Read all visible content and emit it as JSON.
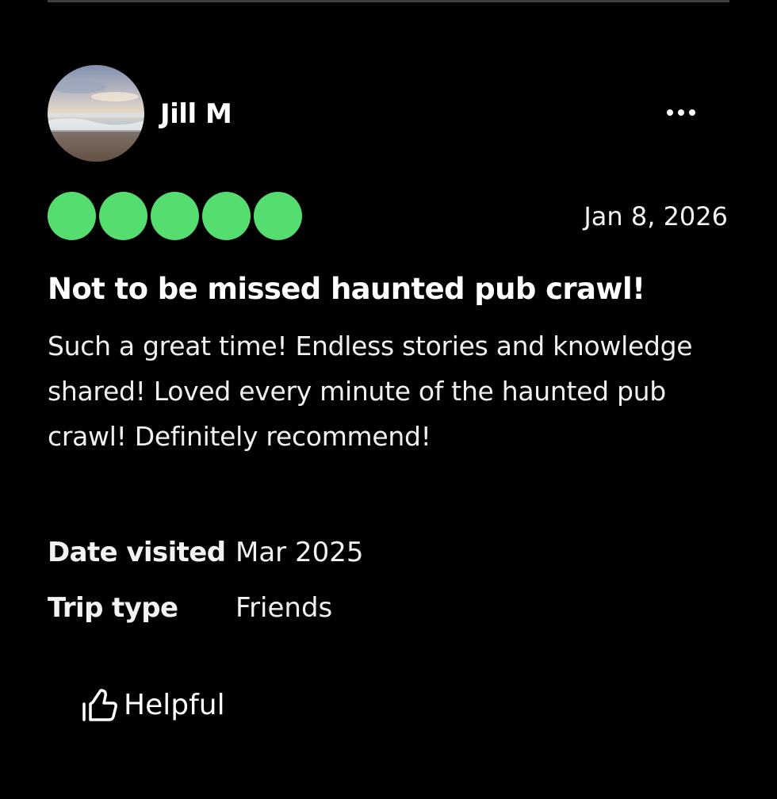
{
  "review": {
    "author": {
      "name": "Jill M",
      "avatar_icon": "beach-photo"
    },
    "menu_icon": "more-dots-icon",
    "rating": {
      "value": 5,
      "max": 5,
      "color": "#56dd6f"
    },
    "date": "Jan 8, 2026",
    "title": "Not to be missed haunted pub crawl!",
    "body": "Such a great time! Endless stories and knowledge shared! Loved every minute of the haunted pub crawl! Definitely recommend!",
    "details": [
      {
        "label": "Date visited",
        "value": "Mar 2025"
      },
      {
        "label": "Trip type",
        "value": "Friends"
      }
    ],
    "helpful": {
      "label": "Helpful",
      "icon": "thumbs-up-icon"
    }
  }
}
